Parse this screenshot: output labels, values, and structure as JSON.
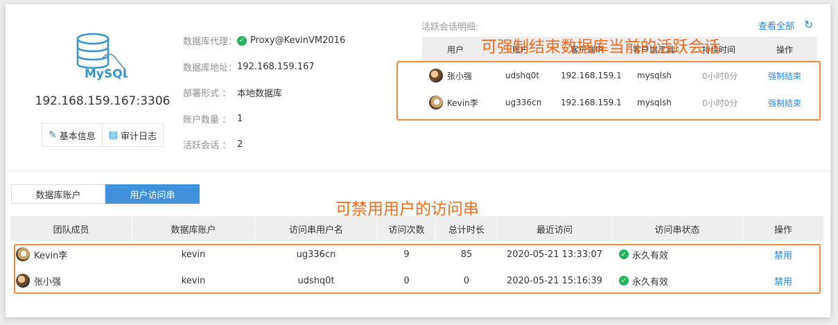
{
  "db": {
    "logo_text": "MySQL",
    "address": "192.168.159.167:3306",
    "buttons": {
      "basic_info": "基本信息",
      "audit_log": "审计日志"
    }
  },
  "info": {
    "proxy_label": "数据库代理：",
    "proxy_value": "Proxy@KevinVM2016",
    "addr_label": "数据库地址：",
    "addr_value": "192.168.159.167",
    "deploy_label": "部署形式 ：",
    "deploy_value": "本地数据库",
    "account_label": "账户数量 ：",
    "account_value": "1",
    "active_label": "活跃会话 ：",
    "active_value": "2"
  },
  "sessions": {
    "title": "活跃会话明细:",
    "view_all": "查看全部",
    "headers": [
      "用户",
      "账户",
      "客户端IP",
      "客户端工具",
      "持续时间",
      "操作"
    ],
    "rows": [
      {
        "user": "张小强",
        "account": "udshq0t",
        "ip": "192.168.159.1",
        "tool": "mysqlsh",
        "duration": "0小时0分",
        "action": "强制结束"
      },
      {
        "user": "Kevin李",
        "account": "ug336cn",
        "ip": "192.168.159.1",
        "tool": "mysqlsh",
        "duration": "0小时0分",
        "action": "强制结束"
      }
    ]
  },
  "annotations": {
    "top": "可强制结束数据库当前的活跃会话",
    "bottom": "可禁用用户的访问串"
  },
  "tabs": [
    {
      "label": "数据库账户",
      "active": false
    },
    {
      "label": "用户访问串",
      "active": true
    }
  ],
  "access": {
    "headers": [
      "团队成员",
      "数据库账户",
      "访问串用户名",
      "访问次数",
      "总计时长",
      "最近访问",
      "访问串状态",
      "操作"
    ],
    "rows": [
      {
        "member": "Kevin李",
        "account": "kevin",
        "username": "ug336cn",
        "count": "9",
        "duration": "85",
        "last": "2020-05-21 13:33:07",
        "status": "永久有效",
        "action": "禁用"
      },
      {
        "member": "张小强",
        "account": "kevin",
        "username": "udshq0t",
        "count": "0",
        "duration": "0",
        "last": "2020-05-21 15:16:39",
        "status": "永久有效",
        "action": "禁用"
      }
    ]
  },
  "colors": {
    "accent": "#3f91dc",
    "annotation": "#f26a1b",
    "ok": "#24b35c"
  }
}
